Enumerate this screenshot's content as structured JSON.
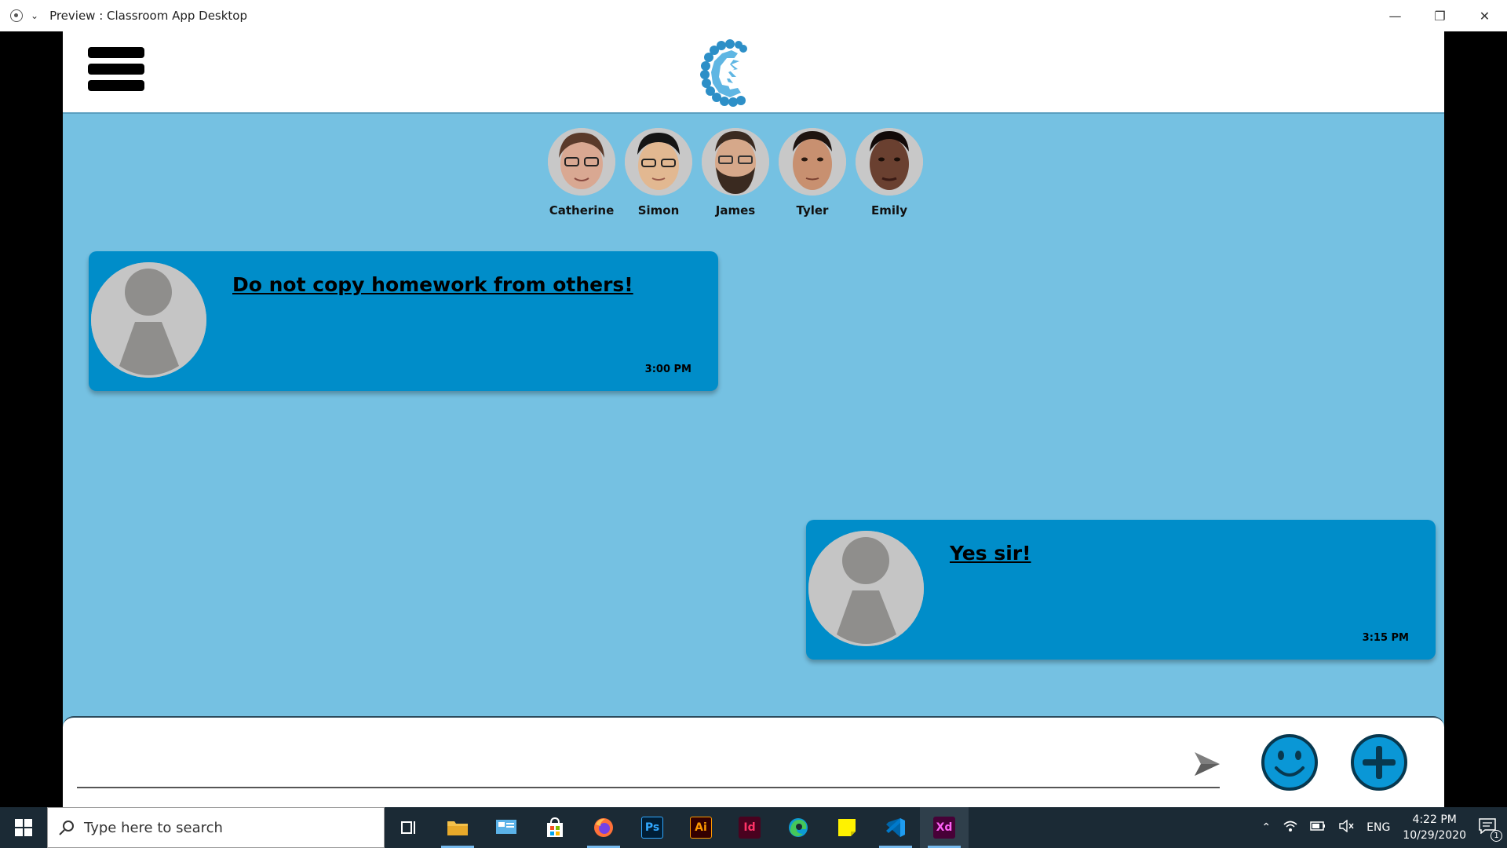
{
  "window": {
    "title": "Preview : Classroom App Desktop",
    "controls": [
      "minimize",
      "restore",
      "close"
    ]
  },
  "students": [
    {
      "name": "Catherine"
    },
    {
      "name": "Simon"
    },
    {
      "name": "James"
    },
    {
      "name": "Tyler"
    },
    {
      "name": "Emily"
    }
  ],
  "messages": [
    {
      "text": "Do not copy homework from others!",
      "time": "3:00 PM"
    },
    {
      "text": "Yes sir!",
      "time": "3:15 PM"
    }
  ],
  "composer": {
    "placeholder": "",
    "value": ""
  },
  "taskbar": {
    "search_placeholder": "Type here to search",
    "apps": [
      {
        "name": "task-view",
        "label": ""
      },
      {
        "name": "file-explorer",
        "label": ""
      },
      {
        "name": "control-panel",
        "label": ""
      },
      {
        "name": "store",
        "label": ""
      },
      {
        "name": "firefox",
        "label": ""
      },
      {
        "name": "photoshop",
        "label": "Ps"
      },
      {
        "name": "illustrator",
        "label": "Ai"
      },
      {
        "name": "indesign",
        "label": "Id"
      },
      {
        "name": "edge",
        "label": ""
      },
      {
        "name": "sticky-notes",
        "label": ""
      },
      {
        "name": "vscode",
        "label": ""
      },
      {
        "name": "xd",
        "label": "Xd"
      }
    ],
    "language": "ENG",
    "time": "4:22 PM",
    "date": "10/29/2020",
    "notification_count": "1"
  },
  "colors": {
    "app_bg": "#75c1e2",
    "bubble": "#008dc9",
    "accent": "#0a97d6"
  }
}
